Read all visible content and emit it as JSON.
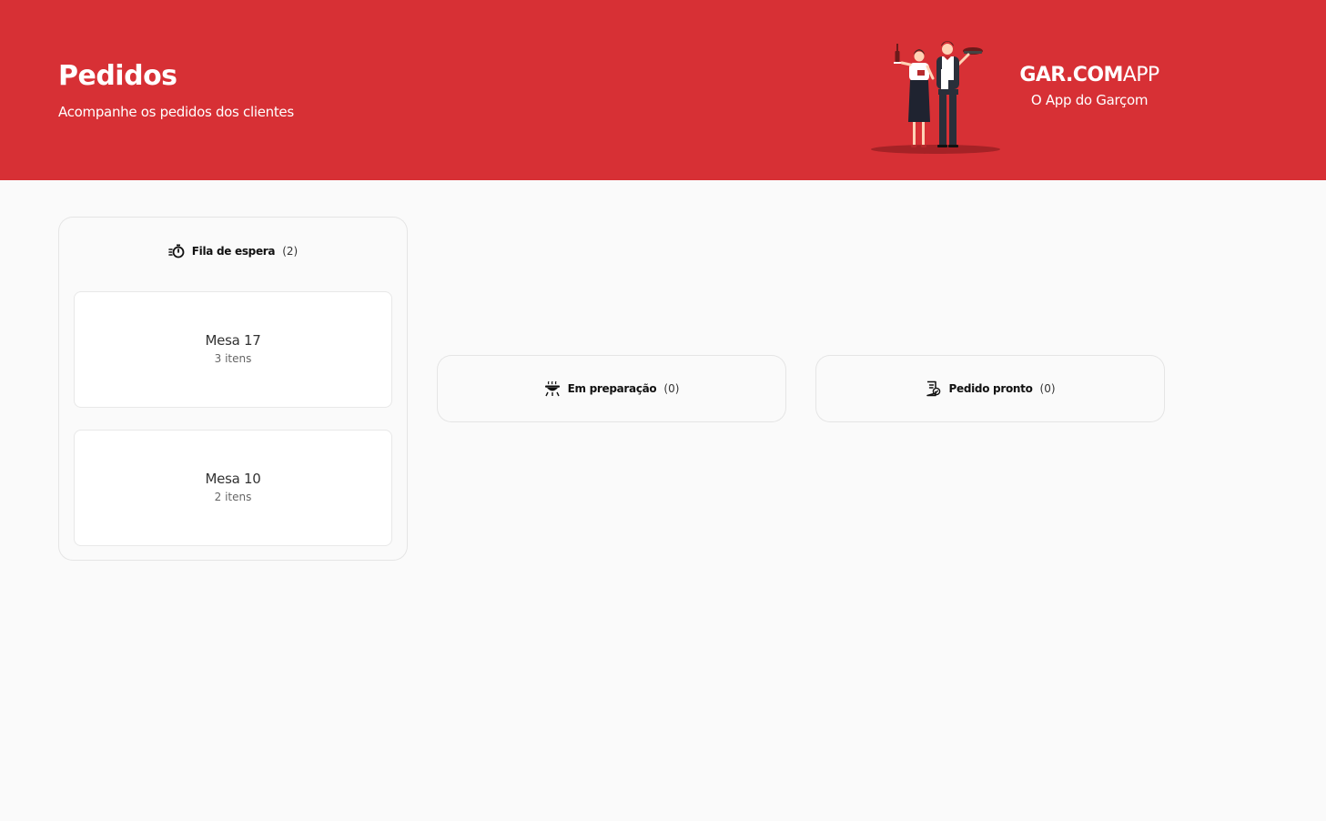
{
  "header": {
    "title": "Pedidos",
    "subtitle": "Acompanhe os pedidos dos clientes"
  },
  "brand": {
    "name_bold": "GAR.COM",
    "name_light": "APP",
    "tagline": "O App do Garçom"
  },
  "colors": {
    "primary": "#d73035",
    "background": "#fafafa",
    "card": "#ffffff",
    "text": "#333333"
  },
  "columns": [
    {
      "icon": "timer-icon",
      "title": "Fila de espera",
      "count": "(2)",
      "orders": [
        {
          "table": "Mesa 17",
          "items": "3 itens"
        },
        {
          "table": "Mesa 10",
          "items": "2 itens"
        }
      ]
    },
    {
      "icon": "cooking-icon",
      "title": "Em preparação",
      "count": "(0)",
      "orders": []
    },
    {
      "icon": "ready-check-icon",
      "title": "Pedido pronto",
      "count": "(0)",
      "orders": []
    }
  ]
}
